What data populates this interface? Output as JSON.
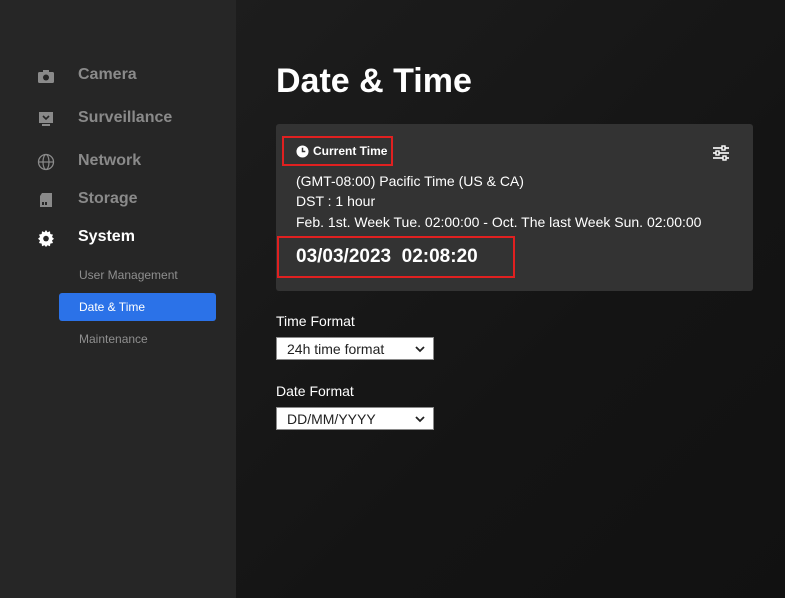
{
  "sidebar": {
    "items": [
      {
        "label": "Camera",
        "icon": "camera-icon"
      },
      {
        "label": "Surveillance",
        "icon": "monitor-icon"
      },
      {
        "label": "Network",
        "icon": "globe-icon"
      },
      {
        "label": "Storage",
        "icon": "storage-icon"
      },
      {
        "label": "System",
        "icon": "gear-icon",
        "active": true
      }
    ],
    "sub_items": [
      {
        "label": "User Management"
      },
      {
        "label": "Date & Time",
        "selected": true
      },
      {
        "label": "Maintenance"
      }
    ]
  },
  "main": {
    "title": "Date & Time",
    "card": {
      "title": "Current Time",
      "timezone": "(GMT-08:00) Pacific Time (US & CA)",
      "dst": "DST : 1 hour",
      "dst_range": "Feb. 1st. Week Tue. 02:00:00 - Oct. The last Week Sun. 02:00:00",
      "current_time": "03/03/2023  02:08:20"
    },
    "time_format": {
      "label": "Time Format",
      "value": "24h time format"
    },
    "date_format": {
      "label": "Date Format",
      "value": "DD/MM/YYYY"
    }
  },
  "colors": {
    "accent": "#2b72e8",
    "highlight": "#e02020",
    "sidebar_bg": "#262626",
    "card_bg": "#333333"
  }
}
